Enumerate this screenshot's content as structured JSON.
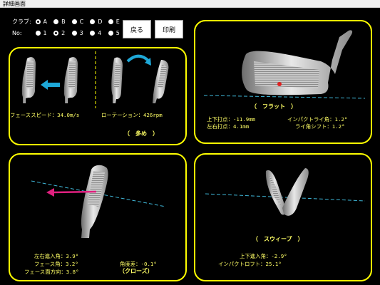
{
  "window": {
    "title": "詳細画面"
  },
  "controls": {
    "club": {
      "label": "クラブ:",
      "options": [
        "A",
        "B",
        "C",
        "D",
        "E"
      ],
      "selected": "A"
    },
    "no": {
      "label": "No:",
      "options": [
        "1",
        "2",
        "3",
        "4",
        "5"
      ],
      "selected": "2"
    },
    "back_button": "戻る",
    "print_button": "印刷"
  },
  "panel_top_left": {
    "face_speed_label": "フェーススピード：34.0m/s",
    "rotation_label": "ローテーション：426rpm",
    "assessment": "（　多め　）"
  },
  "panel_top_right": {
    "assessment": "（　フラット　）",
    "vertical_impact": "上下打点：-11.9mm",
    "horizontal_impact": "左右打点：4.1mm",
    "impact_lie": "インパクトライ角：1.2°",
    "lie_shift": "ライ角シフト：1.2°"
  },
  "panel_bottom_left": {
    "lr_attack": "左右進入角：3.9°",
    "face_angle": "フェース角：3.2°",
    "face_direction": "フェース面方向：3.8°",
    "angle_diff": "角度差：-0.1°",
    "assessment": "（クローズ）"
  },
  "panel_bottom_right": {
    "assessment": "（　スウィープ　）",
    "vertical_attack": "上下進入角：-2.9°",
    "impact_loft": "インパクトロフト：25.1°"
  },
  "colors": {
    "panel_border": "#ffff00",
    "text": "#ffff66",
    "guide_line": "#3fb7d8",
    "arrow_blue": "#1ea8d8",
    "arrow_pink": "#e0207f",
    "impact_dot": "#e02020"
  }
}
